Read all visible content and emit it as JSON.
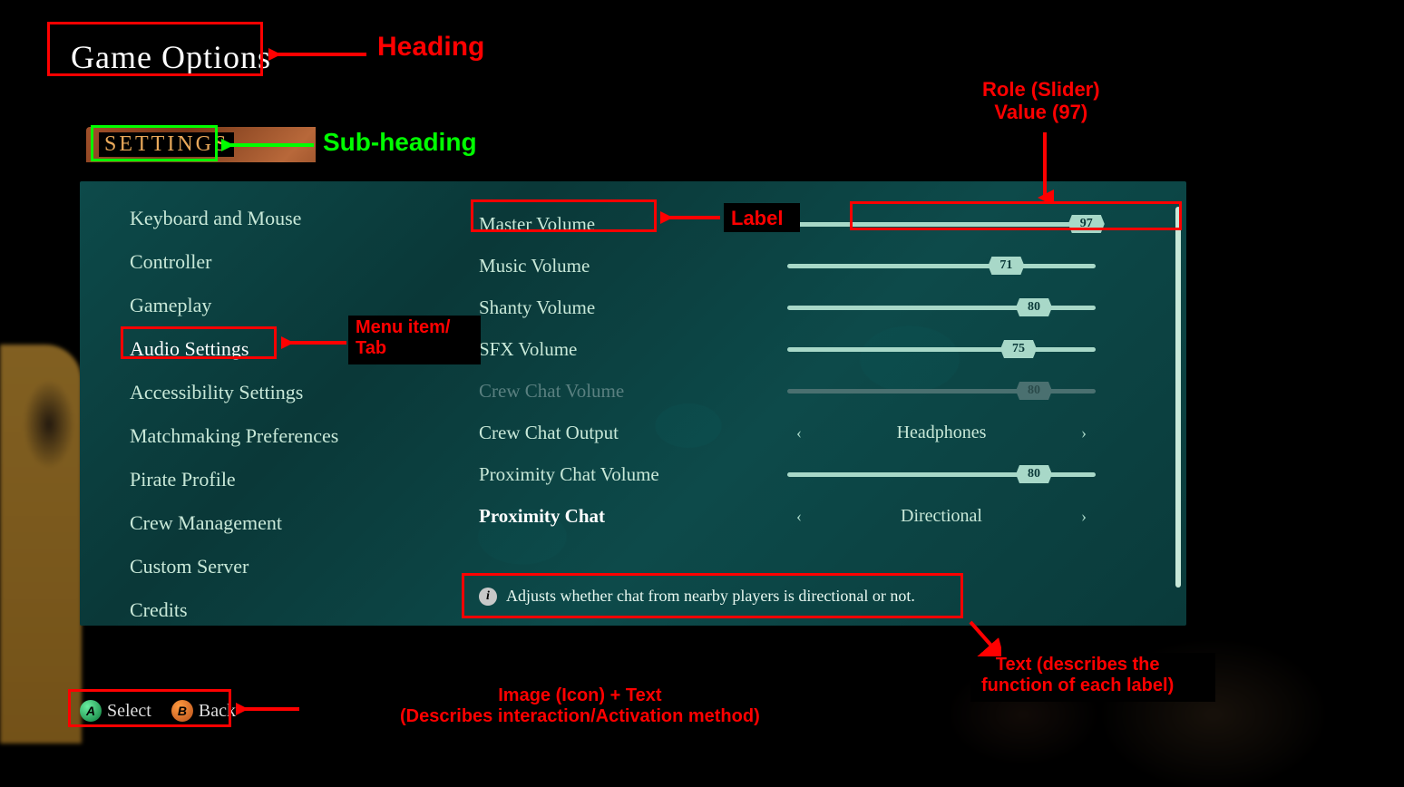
{
  "heading": "Game Options",
  "subheading": "Settings",
  "sidebar": {
    "items": [
      {
        "label": "Keyboard and Mouse",
        "id": "sidebar-item-keyboard-mouse"
      },
      {
        "label": "Controller",
        "id": "sidebar-item-controller"
      },
      {
        "label": "Gameplay",
        "id": "sidebar-item-gameplay"
      },
      {
        "label": "Audio Settings",
        "id": "sidebar-item-audio",
        "active": true
      },
      {
        "label": "Accessibility Settings",
        "id": "sidebar-item-accessibility"
      },
      {
        "label": "Matchmaking Preferences",
        "id": "sidebar-item-matchmaking"
      },
      {
        "label": "Pirate Profile",
        "id": "sidebar-item-pirate-profile"
      },
      {
        "label": "Crew Management",
        "id": "sidebar-item-crew-management"
      },
      {
        "label": "Custom Server",
        "id": "sidebar-item-custom-server"
      },
      {
        "label": "Credits",
        "id": "sidebar-item-credits"
      }
    ]
  },
  "settings": {
    "rows": [
      {
        "type": "slider",
        "label": "Master Volume",
        "value": 97,
        "id": "master-volume"
      },
      {
        "type": "slider",
        "label": "Music Volume",
        "value": 71,
        "id": "music-volume"
      },
      {
        "type": "slider",
        "label": "Shanty Volume",
        "value": 80,
        "id": "shanty-volume"
      },
      {
        "type": "slider",
        "label": "SFX Volume",
        "value": 75,
        "id": "sfx-volume"
      },
      {
        "type": "slider",
        "label": "Crew Chat Volume",
        "value": 80,
        "id": "crew-chat-volume",
        "disabled": true
      },
      {
        "type": "picker",
        "label": "Crew Chat Output",
        "value": "Headphones",
        "id": "crew-chat-output"
      },
      {
        "type": "slider",
        "label": "Proximity Chat Volume",
        "value": 80,
        "id": "proximity-chat-volume"
      },
      {
        "type": "picker",
        "label": "Proximity Chat",
        "value": "Directional",
        "id": "proximity-chat",
        "selected": true
      }
    ]
  },
  "info_text": "Adjusts whether chat from nearby players is directional or not.",
  "hints": {
    "select": {
      "letter": "A",
      "label": "Select"
    },
    "back": {
      "letter": "B",
      "label": "Back"
    }
  },
  "annotations": {
    "heading": "Heading",
    "subheading": "Sub-heading",
    "role_slider_value": "Role (Slider)\nValue (97)",
    "label": "Label",
    "menu_item_tab": "Menu item/\nTab",
    "describes_func": "Text (describes the\nfunction of each label)",
    "icon_text": "Image (Icon) + Text\n(Describes interaction/Activation method)"
  }
}
